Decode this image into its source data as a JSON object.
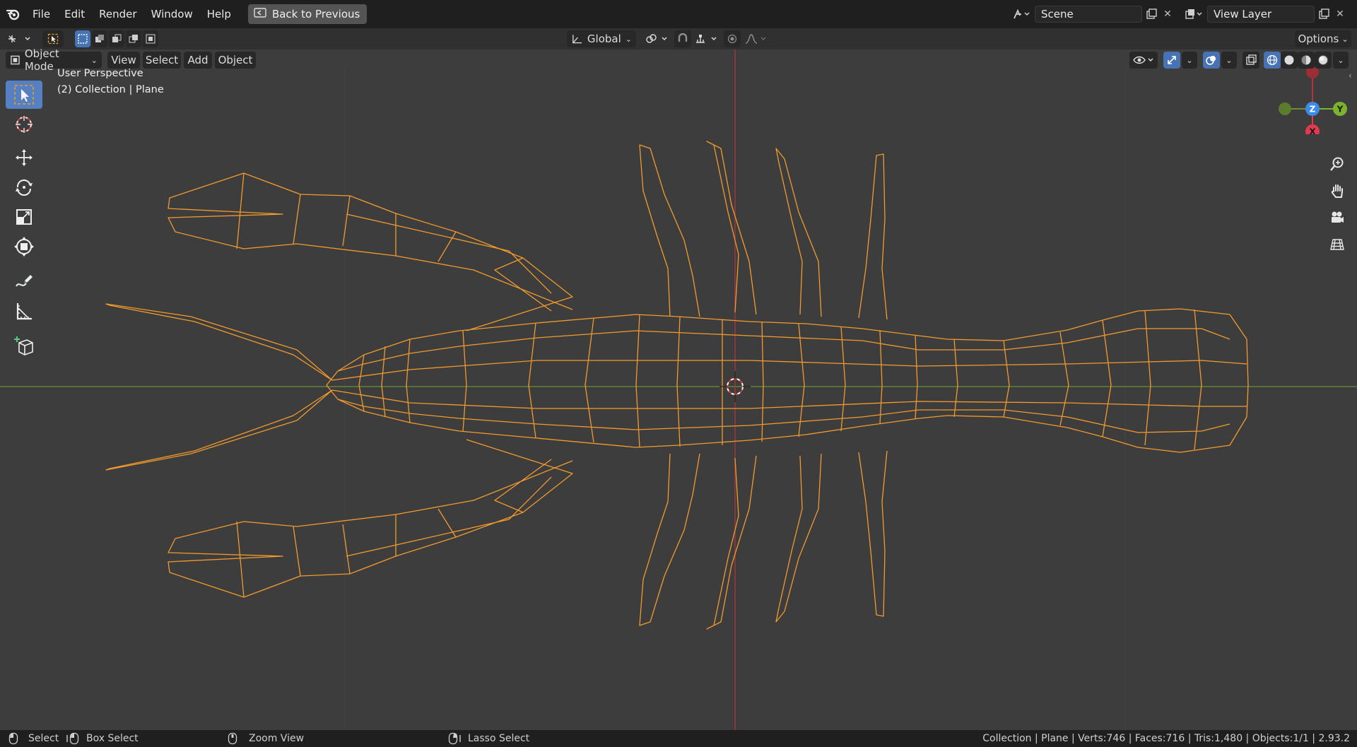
{
  "menu": {
    "items": [
      "File",
      "Edit",
      "Render",
      "Window",
      "Help"
    ],
    "back_label": "Back to Previous"
  },
  "scene": {
    "name": "Scene",
    "view_layer": "View Layer"
  },
  "tool_header": {
    "transform_orientation": "Global",
    "options_label": "Options"
  },
  "viewport_header": {
    "mode": "Object Mode",
    "menus": [
      "View",
      "Select",
      "Add",
      "Object"
    ]
  },
  "overlay": {
    "perspective": "User Perspective",
    "collection": "(2) Collection | Plane"
  },
  "gizmo": {
    "x": "X",
    "y": "Y",
    "z": "Z"
  },
  "status": {
    "select": "Select",
    "box_select": "Box Select",
    "zoom_view": "Zoom View",
    "lasso_select": "Lasso Select",
    "stats": "Collection | Plane | Verts:746 | Faces:716 | Tris:1,480 | Objects:1/1 | 2.93.2"
  },
  "colors": {
    "accent_blue": "#4772b3",
    "wire_selected": "#f29a2e",
    "axis_red": "#b3363c",
    "axis_green": "#6b8f34",
    "gizmo_x": "#e03a4f",
    "gizmo_y": "#7bb32e",
    "gizmo_z": "#3d8ae8"
  },
  "icons": {
    "blender_logo": "blender-icon",
    "select_tool": "cursor-select-icon",
    "cursor_tool": "3d-cursor-icon",
    "move_tool": "move-icon",
    "rotate_tool": "rotate-icon",
    "scale_tool": "scale-icon",
    "transform_tool": "transform-icon",
    "annotate_tool": "annotate-icon",
    "measure_tool": "measure-icon",
    "add_cube_tool": "add-cube-icon",
    "zoom_nav": "zoom-icon",
    "pan_nav": "hand-icon",
    "camera_nav": "camera-icon",
    "ortho_nav": "grid-icon"
  }
}
